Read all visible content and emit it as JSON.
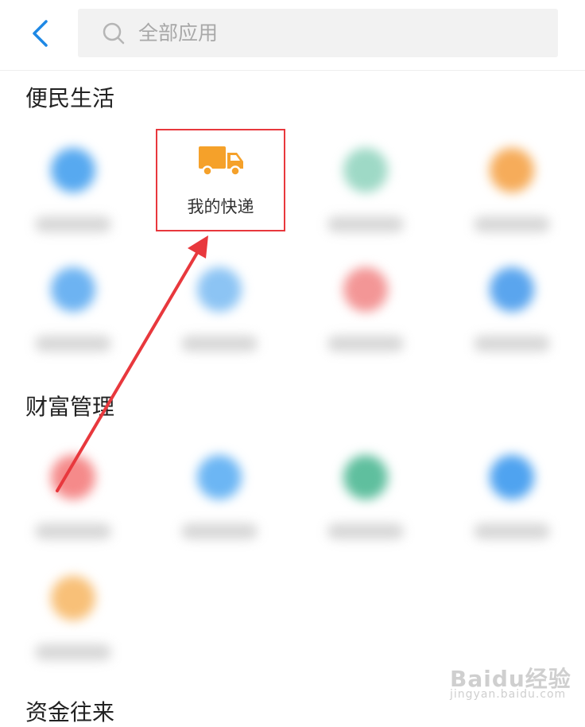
{
  "header": {
    "back_icon": "chevron-left-icon",
    "search_icon": "search-icon",
    "search_placeholder": "全部应用",
    "accent": "#1e88e5"
  },
  "sections": [
    {
      "title": "便民生活"
    },
    {
      "title": "财富管理"
    },
    {
      "title": "资金往来"
    }
  ],
  "highlight": {
    "label": "我的快递",
    "icon": "truck-icon",
    "icon_color": "#f5a12a",
    "border_color": "#e8383d"
  },
  "annotation": {
    "icon": "red-arrow",
    "color": "#e8383d"
  },
  "watermark": {
    "brand": "Baidu经验",
    "url": "jingyan.baidu.com"
  }
}
